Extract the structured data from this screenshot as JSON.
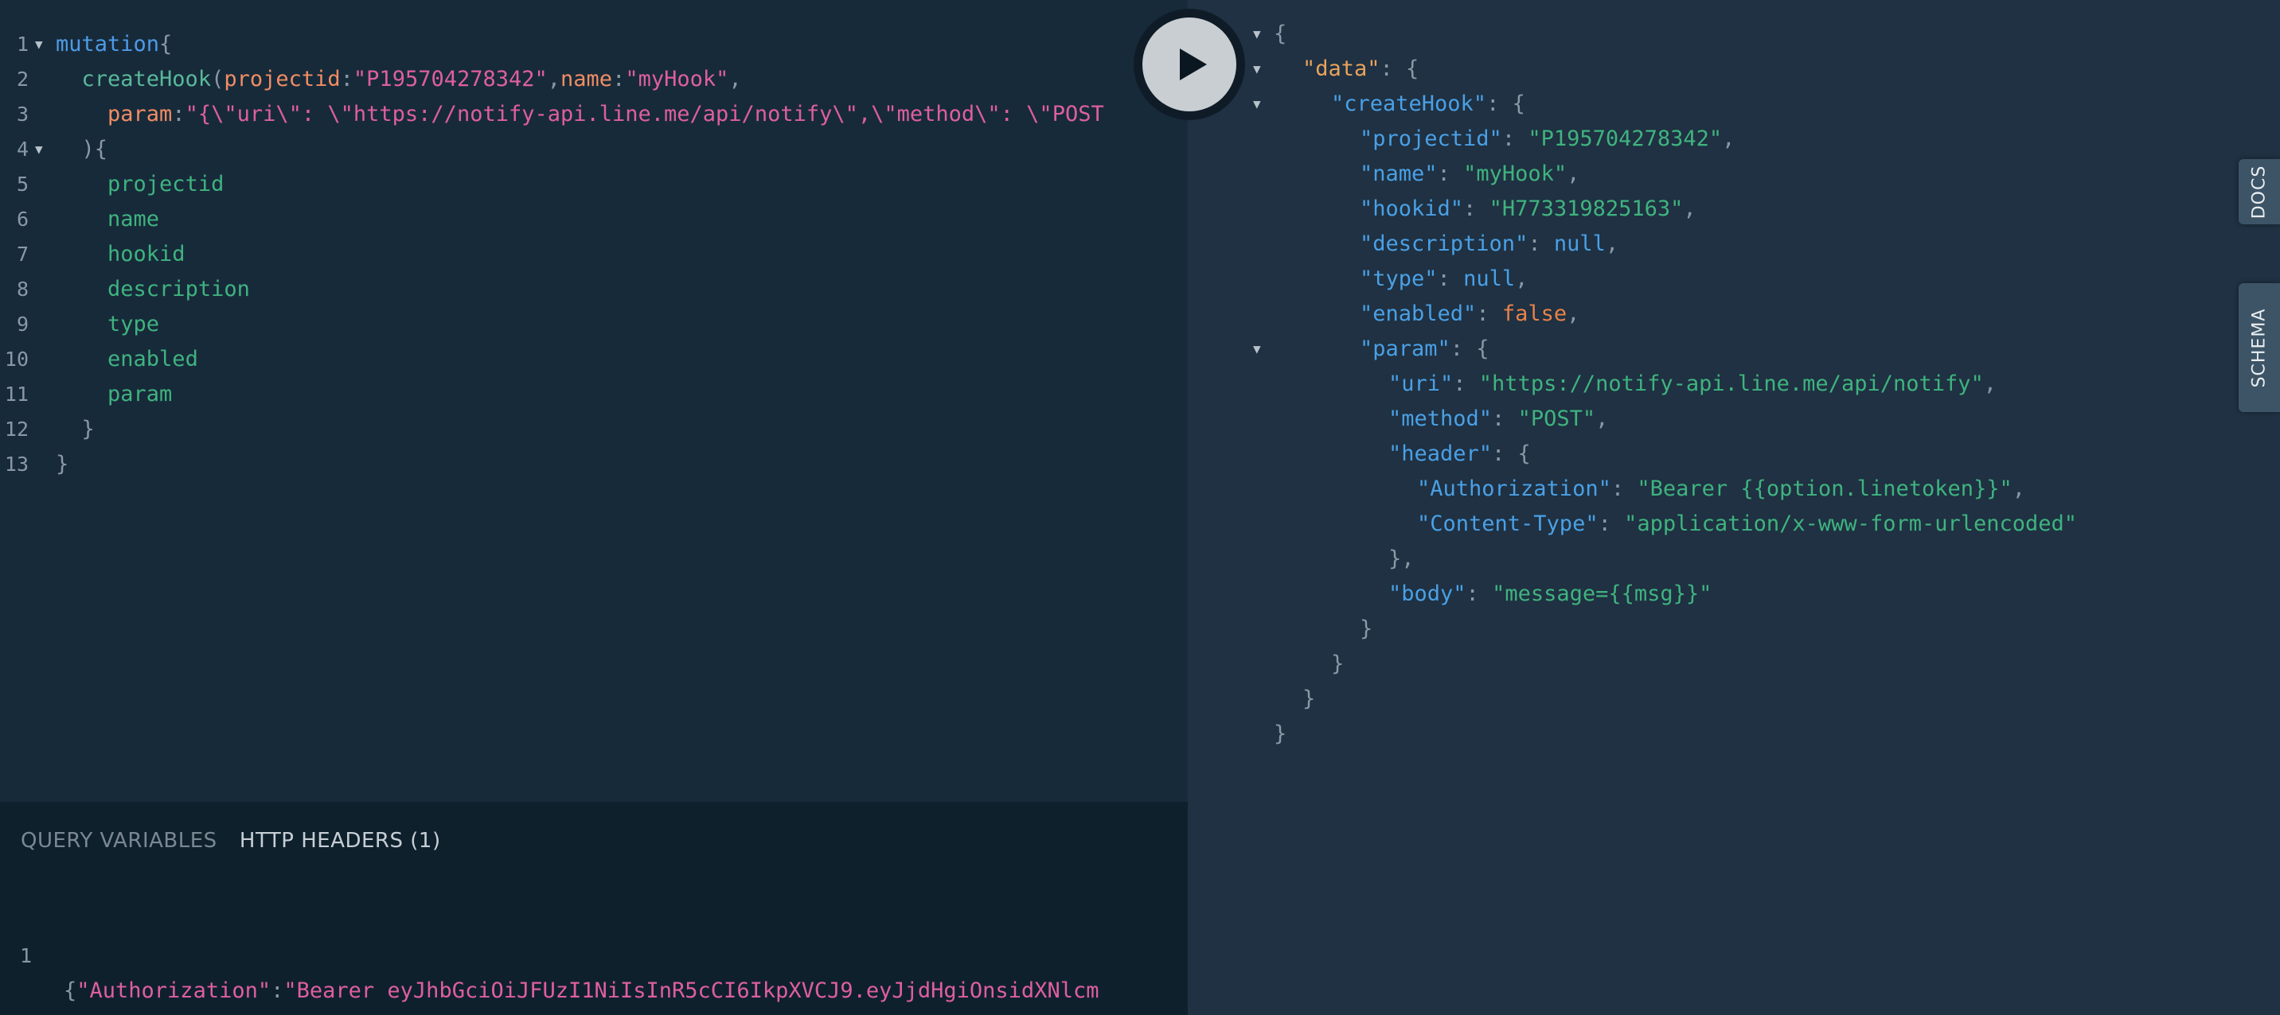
{
  "query_editor": {
    "lines": [
      {
        "n": "1",
        "fold": true,
        "segs": [
          [
            "kw",
            "mutation"
          ],
          [
            "pun",
            "{"
          ]
        ]
      },
      {
        "n": "2",
        "segs": [
          [
            "pun",
            "  "
          ],
          [
            "fn",
            "createHook"
          ],
          [
            "pun",
            "("
          ],
          [
            "arg",
            "projectid"
          ],
          [
            "pun",
            ":"
          ],
          [
            "str",
            "\"P195704278342\""
          ],
          [
            "pun",
            ","
          ],
          [
            "arg",
            "name"
          ],
          [
            "pun",
            ":"
          ],
          [
            "str",
            "\"myHook\""
          ],
          [
            "pun",
            ","
          ]
        ]
      },
      {
        "n": "3",
        "segs": [
          [
            "pun",
            "    "
          ],
          [
            "arg",
            "param"
          ],
          [
            "pun",
            ":"
          ],
          [
            "str",
            "\"{\\\"uri\\\": \\\"https://notify-api.line.me/api/notify\\\",\\\"method\\\": \\\"POST"
          ]
        ]
      },
      {
        "n": "4",
        "fold": true,
        "segs": [
          [
            "pun",
            "  ){"
          ]
        ]
      },
      {
        "n": "5",
        "segs": [
          [
            "pun",
            "    "
          ],
          [
            "fld",
            "projectid"
          ]
        ]
      },
      {
        "n": "6",
        "segs": [
          [
            "pun",
            "    "
          ],
          [
            "fld",
            "name"
          ]
        ]
      },
      {
        "n": "7",
        "segs": [
          [
            "pun",
            "    "
          ],
          [
            "fld",
            "hookid"
          ]
        ]
      },
      {
        "n": "8",
        "segs": [
          [
            "pun",
            "    "
          ],
          [
            "fld",
            "description"
          ]
        ]
      },
      {
        "n": "9",
        "segs": [
          [
            "pun",
            "    "
          ],
          [
            "fld",
            "type"
          ]
        ]
      },
      {
        "n": "10",
        "segs": [
          [
            "pun",
            "    "
          ],
          [
            "fld",
            "enabled"
          ]
        ]
      },
      {
        "n": "11",
        "segs": [
          [
            "pun",
            "    "
          ],
          [
            "fld",
            "param"
          ]
        ]
      },
      {
        "n": "12",
        "segs": [
          [
            "pun",
            "  }"
          ]
        ]
      },
      {
        "n": "13",
        "segs": [
          [
            "pun",
            "}"
          ]
        ]
      }
    ]
  },
  "bottom_panel": {
    "tabs": [
      {
        "label": "QUERY VARIABLES",
        "active": false
      },
      {
        "label": "HTTP HEADERS (1)",
        "active": true
      }
    ],
    "line_number": "1",
    "segs": [
      [
        "pun",
        "{"
      ],
      [
        "str",
        "\"Authorization\""
      ],
      [
        "pun",
        ":"
      ],
      [
        "str",
        "\"Bearer eyJhbGciOiJFUzI1NiIsInR5cCI6IkpXVCJ9.eyJjdHgiOnsidXNlcm"
      ]
    ]
  },
  "result": {
    "lines": [
      {
        "fold": true,
        "ind": 0,
        "segs": [
          [
            "rp",
            "{"
          ]
        ]
      },
      {
        "fold": true,
        "ind": 1,
        "segs": [
          [
            "okey",
            "\"data\""
          ],
          [
            "rp",
            ": {"
          ]
        ]
      },
      {
        "fold": true,
        "ind": 2,
        "segs": [
          [
            "key",
            "\"createHook\""
          ],
          [
            "rp",
            ": {"
          ]
        ]
      },
      {
        "ind": 3,
        "segs": [
          [
            "key",
            "\"projectid\""
          ],
          [
            "rp",
            ": "
          ],
          [
            "rstr",
            "\"P195704278342\""
          ],
          [
            "rp",
            ","
          ]
        ]
      },
      {
        "ind": 3,
        "segs": [
          [
            "key",
            "\"name\""
          ],
          [
            "rp",
            ": "
          ],
          [
            "rstr",
            "\"myHook\""
          ],
          [
            "rp",
            ","
          ]
        ]
      },
      {
        "ind": 3,
        "segs": [
          [
            "key",
            "\"hookid\""
          ],
          [
            "rp",
            ": "
          ],
          [
            "rstr",
            "\"H773319825163\""
          ],
          [
            "rp",
            ","
          ]
        ]
      },
      {
        "ind": 3,
        "segs": [
          [
            "key",
            "\"description\""
          ],
          [
            "rp",
            ": "
          ],
          [
            "rnull",
            "null"
          ],
          [
            "rp",
            ","
          ]
        ]
      },
      {
        "ind": 3,
        "segs": [
          [
            "key",
            "\"type\""
          ],
          [
            "rp",
            ": "
          ],
          [
            "rnull",
            "null"
          ],
          [
            "rp",
            ","
          ]
        ]
      },
      {
        "ind": 3,
        "segs": [
          [
            "key",
            "\"enabled\""
          ],
          [
            "rp",
            ": "
          ],
          [
            "rbool",
            "false"
          ],
          [
            "rp",
            ","
          ]
        ]
      },
      {
        "fold": true,
        "ind": 3,
        "segs": [
          [
            "key",
            "\"param\""
          ],
          [
            "rp",
            ": {"
          ]
        ]
      },
      {
        "ind": 4,
        "segs": [
          [
            "key",
            "\"uri\""
          ],
          [
            "rp",
            ": "
          ],
          [
            "rstr",
            "\"https://notify-api.line.me/api/notify\""
          ],
          [
            "rp",
            ","
          ]
        ]
      },
      {
        "ind": 4,
        "segs": [
          [
            "key",
            "\"method\""
          ],
          [
            "rp",
            ": "
          ],
          [
            "rstr",
            "\"POST\""
          ],
          [
            "rp",
            ","
          ]
        ]
      },
      {
        "ind": 4,
        "segs": [
          [
            "key",
            "\"header\""
          ],
          [
            "rp",
            ": {"
          ]
        ]
      },
      {
        "ind": 5,
        "segs": [
          [
            "key",
            "\"Authorization\""
          ],
          [
            "rp",
            ": "
          ],
          [
            "rstr",
            "\"Bearer {{option.linetoken}}\""
          ],
          [
            "rp",
            ","
          ]
        ]
      },
      {
        "ind": 5,
        "segs": [
          [
            "key",
            "\"Content-Type\""
          ],
          [
            "rp",
            ": "
          ],
          [
            "rstr",
            "\"application/x-www-form-urlencoded\""
          ]
        ]
      },
      {
        "ind": 4,
        "segs": [
          [
            "rp",
            "},"
          ]
        ]
      },
      {
        "ind": 4,
        "segs": [
          [
            "key",
            "\"body\""
          ],
          [
            "rp",
            ": "
          ],
          [
            "rstr",
            "\"message={{msg}}\""
          ]
        ]
      },
      {
        "ind": 3,
        "segs": [
          [
            "rp",
            "}"
          ]
        ]
      },
      {
        "ind": 2,
        "segs": [
          [
            "rp",
            "}"
          ]
        ]
      },
      {
        "ind": 1,
        "segs": [
          [
            "rp",
            "}"
          ]
        ]
      },
      {
        "ind": 0,
        "segs": [
          [
            "rp",
            "}"
          ]
        ]
      }
    ]
  },
  "side_tabs": {
    "docs": "DOCS",
    "schema": "SCHEMA"
  }
}
